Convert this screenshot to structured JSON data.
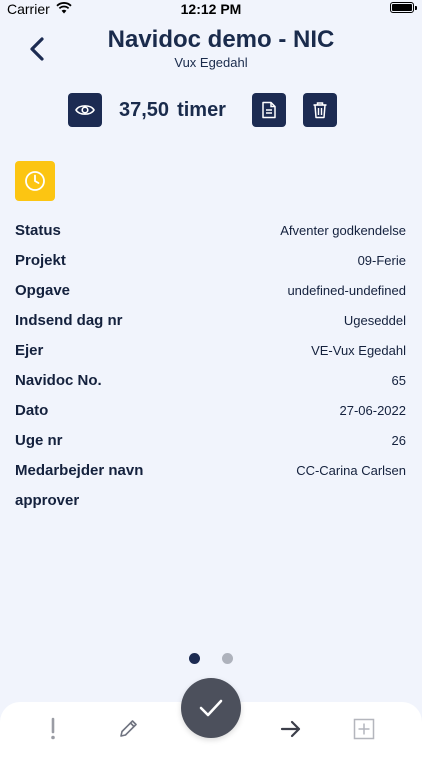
{
  "status_bar": {
    "carrier": "Carrier",
    "time": "12:12 PM"
  },
  "header": {
    "title": "Navidoc demo - NIC",
    "subtitle": "Vux Egedahl"
  },
  "summary": {
    "hours": "37,50",
    "unit": "timer"
  },
  "details": [
    {
      "label": "Status",
      "value": "Afventer godkendelse"
    },
    {
      "label": "Projekt",
      "value": "09-Ferie"
    },
    {
      "label": "Opgave",
      "value": "undefined-undefined"
    },
    {
      "label": "Indsend dag nr",
      "value": "Ugeseddel"
    },
    {
      "label": "Ejer",
      "value": "VE-Vux Egedahl"
    },
    {
      "label": "Navidoc No.",
      "value": "65"
    },
    {
      "label": "Dato",
      "value": "27-06-2022"
    },
    {
      "label": "Uge nr",
      "value": "26"
    },
    {
      "label": "Medarbejder navn",
      "value": "CC-Carina Carlsen"
    },
    {
      "label": "approver",
      "value": ""
    }
  ],
  "pagination": {
    "pages": 2,
    "current": 1
  },
  "icons": {
    "back": "chevron-left-icon",
    "view": "eye-icon",
    "document": "document-icon",
    "delete": "trash-icon",
    "status": "clock-icon",
    "tabs": [
      "exclamation-icon",
      "pencil-icon",
      "checkmark-icon",
      "arrow-right-icon",
      "plus-square-icon"
    ]
  },
  "colors": {
    "background": "#f1f4fc",
    "navy": "#1c2b52",
    "status_yellow": "#fcc512",
    "fab": "#4c505c",
    "tab_icon": "#9a9ca4"
  }
}
